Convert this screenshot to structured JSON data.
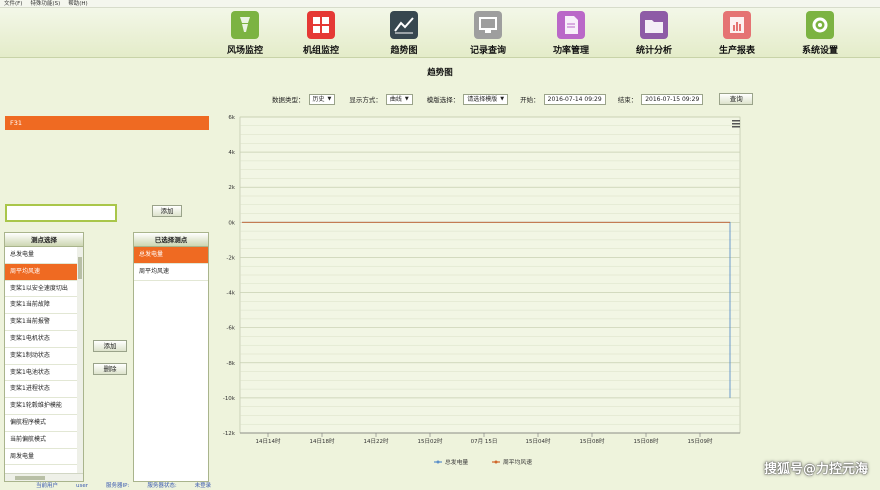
{
  "menubar": {
    "items": [
      "文件(F)",
      "特殊功能(S)",
      "帮助(H)"
    ]
  },
  "topnav": {
    "items": [
      {
        "label": "风场监控",
        "icon": "wind-turbine-icon",
        "color": "#7cb342"
      },
      {
        "label": "机组监控",
        "icon": "grid-icon",
        "color": "#e53935"
      },
      {
        "label": "趋势图",
        "icon": "line-chart-icon",
        "color": "#37474f"
      },
      {
        "label": "记录查询",
        "icon": "monitor-icon",
        "color": "#9e9e9e"
      },
      {
        "label": "功率管理",
        "icon": "document-icon",
        "color": "#ba68c8"
      },
      {
        "label": "统计分析",
        "icon": "folder-icon",
        "color": "#8e5ba6"
      },
      {
        "label": "生产报表",
        "icon": "report-icon",
        "color": "#e57373"
      },
      {
        "label": "系统设置",
        "icon": "gear-icon",
        "color": "#7cb342"
      }
    ]
  },
  "page": {
    "title": "趋势图"
  },
  "controls": {
    "data_type_label": "数据类型：",
    "data_type_value": "历史",
    "display_label": "显示方式：",
    "display_value": "曲线",
    "template_label": "模版选择：",
    "template_value": "请选择模版",
    "start_label": "开始：",
    "start_value": "2016-07-14 09:29",
    "end_label": "结束：",
    "end_value": "2016-07-15 09:29",
    "query_label": "查询"
  },
  "left": {
    "turbine_label": "F31",
    "add_label": "添加",
    "points_header": "测点选择",
    "points": [
      "总发电量",
      "周平均风速",
      "变桨1以安全速度切出",
      "变桨1当前故障",
      "变桨1当前报警",
      "变桨1电机状态",
      "变桨1制动状态",
      "变桨1电池状态",
      "变桨1进程状态",
      "变桨1轮毂维护模能",
      "偏航程序模式",
      "当前偏航模式",
      "周发电量"
    ],
    "selected_index": 1,
    "mid_add_label": "添加",
    "mid_delete_label": "删除",
    "selected_header": "已选择测点",
    "selected_points": [
      "总发电量",
      "周平均风速"
    ]
  },
  "chart_data": {
    "type": "line",
    "x": [
      "14日14时",
      "14日18时",
      "14日22时",
      "15日02时",
      "07月 15日",
      "15日04时",
      "15日08时",
      "15日08时",
      "15日09时"
    ],
    "y_ticks": [
      "6k",
      "4k",
      "2k",
      "0k",
      "-2k",
      "-4k",
      "-6k",
      "-8k",
      "-10k",
      "-12k"
    ],
    "ylim": [
      -12000,
      6000
    ],
    "series": [
      {
        "name": "总发电量",
        "color": "#5b8fc9",
        "values": [
          0,
          0,
          0,
          0,
          0,
          0,
          0,
          0,
          -10000
        ]
      },
      {
        "name": "周平均风速",
        "color": "#d0662a",
        "values": [
          0,
          0,
          0,
          0,
          0,
          0,
          0,
          0,
          0
        ]
      }
    ],
    "legend_position": "bottom",
    "grid": true
  },
  "status": {
    "items": [
      "当前用户",
      "user",
      "服务器IP:",
      "服务器状态:",
      "未登录"
    ]
  },
  "watermark": {
    "text": "搜狐号@力控元海"
  }
}
